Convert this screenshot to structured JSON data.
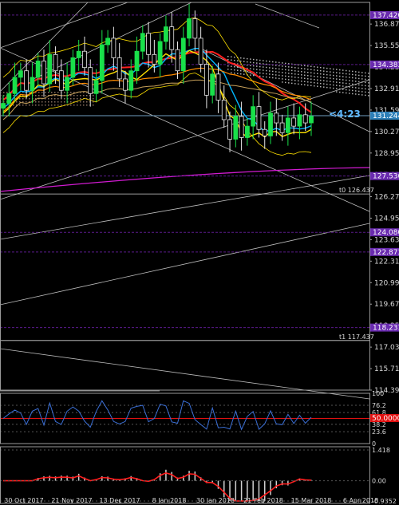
{
  "colors": {
    "background": "#000000",
    "frame": "#9a9a9a",
    "text": "#d8d8d8",
    "bull": "#19e04a",
    "bear": "#e8e8e8",
    "level_line": "#5a1a8a",
    "level_tag": "#6a2bb0",
    "current_tag": "#2d7fb8",
    "trendline": "#bdbdbd",
    "ma_red": "#ff1e1e",
    "ma_yellow": "#ffe100",
    "ma_cyan": "#00b7ff",
    "ma_magenta": "#d21bd2",
    "ma_orange": "#ff8c00",
    "ma_tan": "#c8a15a",
    "cloud": "#b0b0b0",
    "rsi_line": "#3b6fd6",
    "rsi_ref": "#e01010",
    "macd_line": "#ff1e1e",
    "hist": "#d0d0d0"
  },
  "price_axis": {
    "min": 114.39,
    "max": 138.2,
    "ticks": [
      "136.870",
      "135.550",
      "134.230",
      "132.910",
      "131.590",
      "130.270",
      "128.950",
      "127.630",
      "126.270",
      "124.950",
      "123.630",
      "122.310",
      "120.990",
      "119.670",
      "118.350",
      "117.030",
      "115.710",
      "114.390"
    ]
  },
  "levels": [
    {
      "label": "137.420",
      "value": 137.42
    },
    {
      "label": "134.383",
      "value": 134.383
    },
    {
      "label": "131.244",
      "value": 131.244,
      "current": true
    },
    {
      "label": "127.536",
      "value": 127.536
    },
    {
      "label": "124.080",
      "value": 124.08
    },
    {
      "label": "122.873",
      "value": 122.873
    },
    {
      "label": "118.231",
      "value": 118.231
    }
  ],
  "line_annotations": [
    {
      "text": "t0 126.437",
      "value": 126.437
    },
    {
      "text": "t1 117.437",
      "value": 117.437
    }
  ],
  "countdown": "<4:23",
  "dates": [
    "30 Oct 2017",
    "21 Nov 2017",
    "13 Dec 2017",
    "8 Jan 2018",
    "30 Jan 2018",
    "21 Feb 2018",
    "15 Mar 2018",
    "6 Apr 2018"
  ],
  "rsi_panel": {
    "ticks": [
      "100",
      "76.2",
      "61.8",
      "38.2",
      "23.6",
      "0"
    ],
    "ref_label": "50.0000"
  },
  "macd_panel": {
    "ticks": [
      "1.418",
      "0.00",
      "-0.9352"
    ]
  },
  "chart_data": {
    "type": "candlestick",
    "instrument_timeframe": "daily",
    "x_dates": [
      "30 Oct 2017",
      "21 Nov 2017",
      "13 Dec 2017",
      "8 Jan 2018",
      "30 Jan 2018",
      "21 Feb 2018",
      "15 Mar 2018",
      "6 Apr 2018"
    ],
    "series": [
      {
        "name": "price",
        "values": [
          132.0,
          132.6,
          133.6,
          134.0,
          132.8,
          133.6,
          134.6,
          133.2,
          135.0,
          134.0,
          132.8,
          133.6,
          134.8,
          135.2,
          134.2,
          132.6,
          133.4,
          135.6,
          136.0,
          134.8,
          133.5,
          132.8,
          134.0,
          135.2,
          136.3,
          135.0,
          134.4,
          135.8,
          136.7,
          135.3,
          134.0,
          136.0,
          137.2,
          136.0,
          134.4,
          132.5,
          133.8,
          132.2,
          131.0,
          129.8,
          131.2,
          129.9,
          130.6,
          131.8,
          130.4,
          130.0,
          131.4,
          130.8,
          130.2,
          131.1,
          130.6,
          131.3,
          130.8,
          131.2
        ]
      }
    ],
    "ylim": [
      114.39,
      138.2
    ]
  }
}
